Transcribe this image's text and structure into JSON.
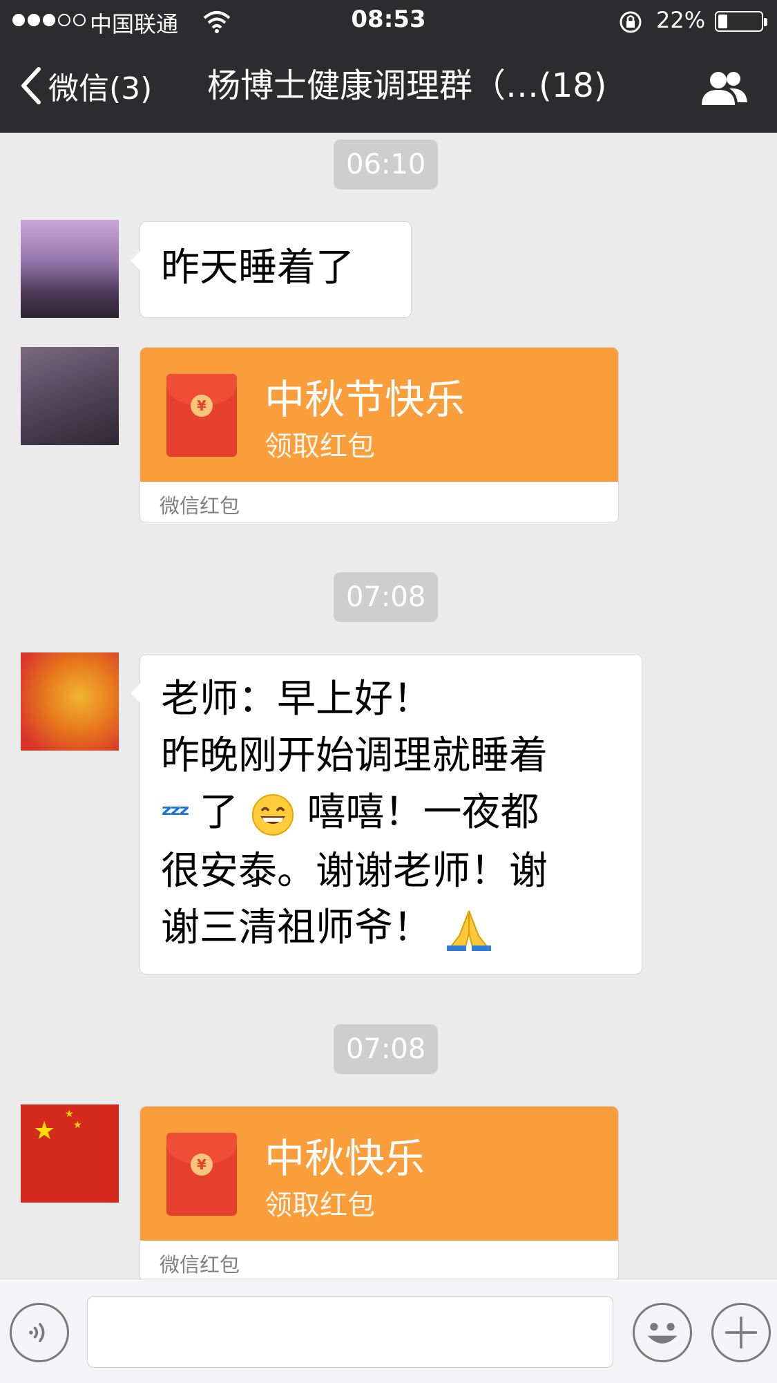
{
  "status_bar": {
    "carrier": "中国联通",
    "time": "08:53",
    "battery_percent": "22%",
    "battery_level": 0.22
  },
  "nav": {
    "back_label": "微信(3)",
    "title": "杨博士健康调理群（…(18)"
  },
  "messages": [
    {
      "type": "time",
      "text": "06:10"
    },
    {
      "type": "text",
      "text": "昨天睡着了"
    },
    {
      "type": "red_packet",
      "title": "中秋节快乐",
      "subtitle": "领取红包",
      "footer": "微信红包"
    },
    {
      "type": "time",
      "text": "07:08"
    },
    {
      "type": "text",
      "line1": "老师：早上好！",
      "line2": "昨晚刚开始调理就睡着",
      "line3_a": "了",
      "line3_b": "嘻嘻！一夜都",
      "line4": "很安泰。谢谢老师！谢",
      "line5": "谢三清祖师爷！"
    },
    {
      "type": "time",
      "text": "07:08"
    },
    {
      "type": "red_packet",
      "title": "中秋快乐",
      "subtitle": "领取红包",
      "footer": "微信红包"
    }
  ],
  "colors": {
    "nav_bg": "#2c2c2e",
    "chat_bg": "#ebebeb",
    "red_packet": "#f99e3b",
    "time_badge": "#cecece"
  },
  "icons": {
    "back": "chevron-left-icon",
    "group": "group-members-icon",
    "voice": "voice-icon",
    "emoji": "smiley-icon",
    "more": "plus-icon",
    "sleep": "zzz-icon",
    "grin": "grin-emoji-icon",
    "pray": "pray-emoji-icon"
  }
}
